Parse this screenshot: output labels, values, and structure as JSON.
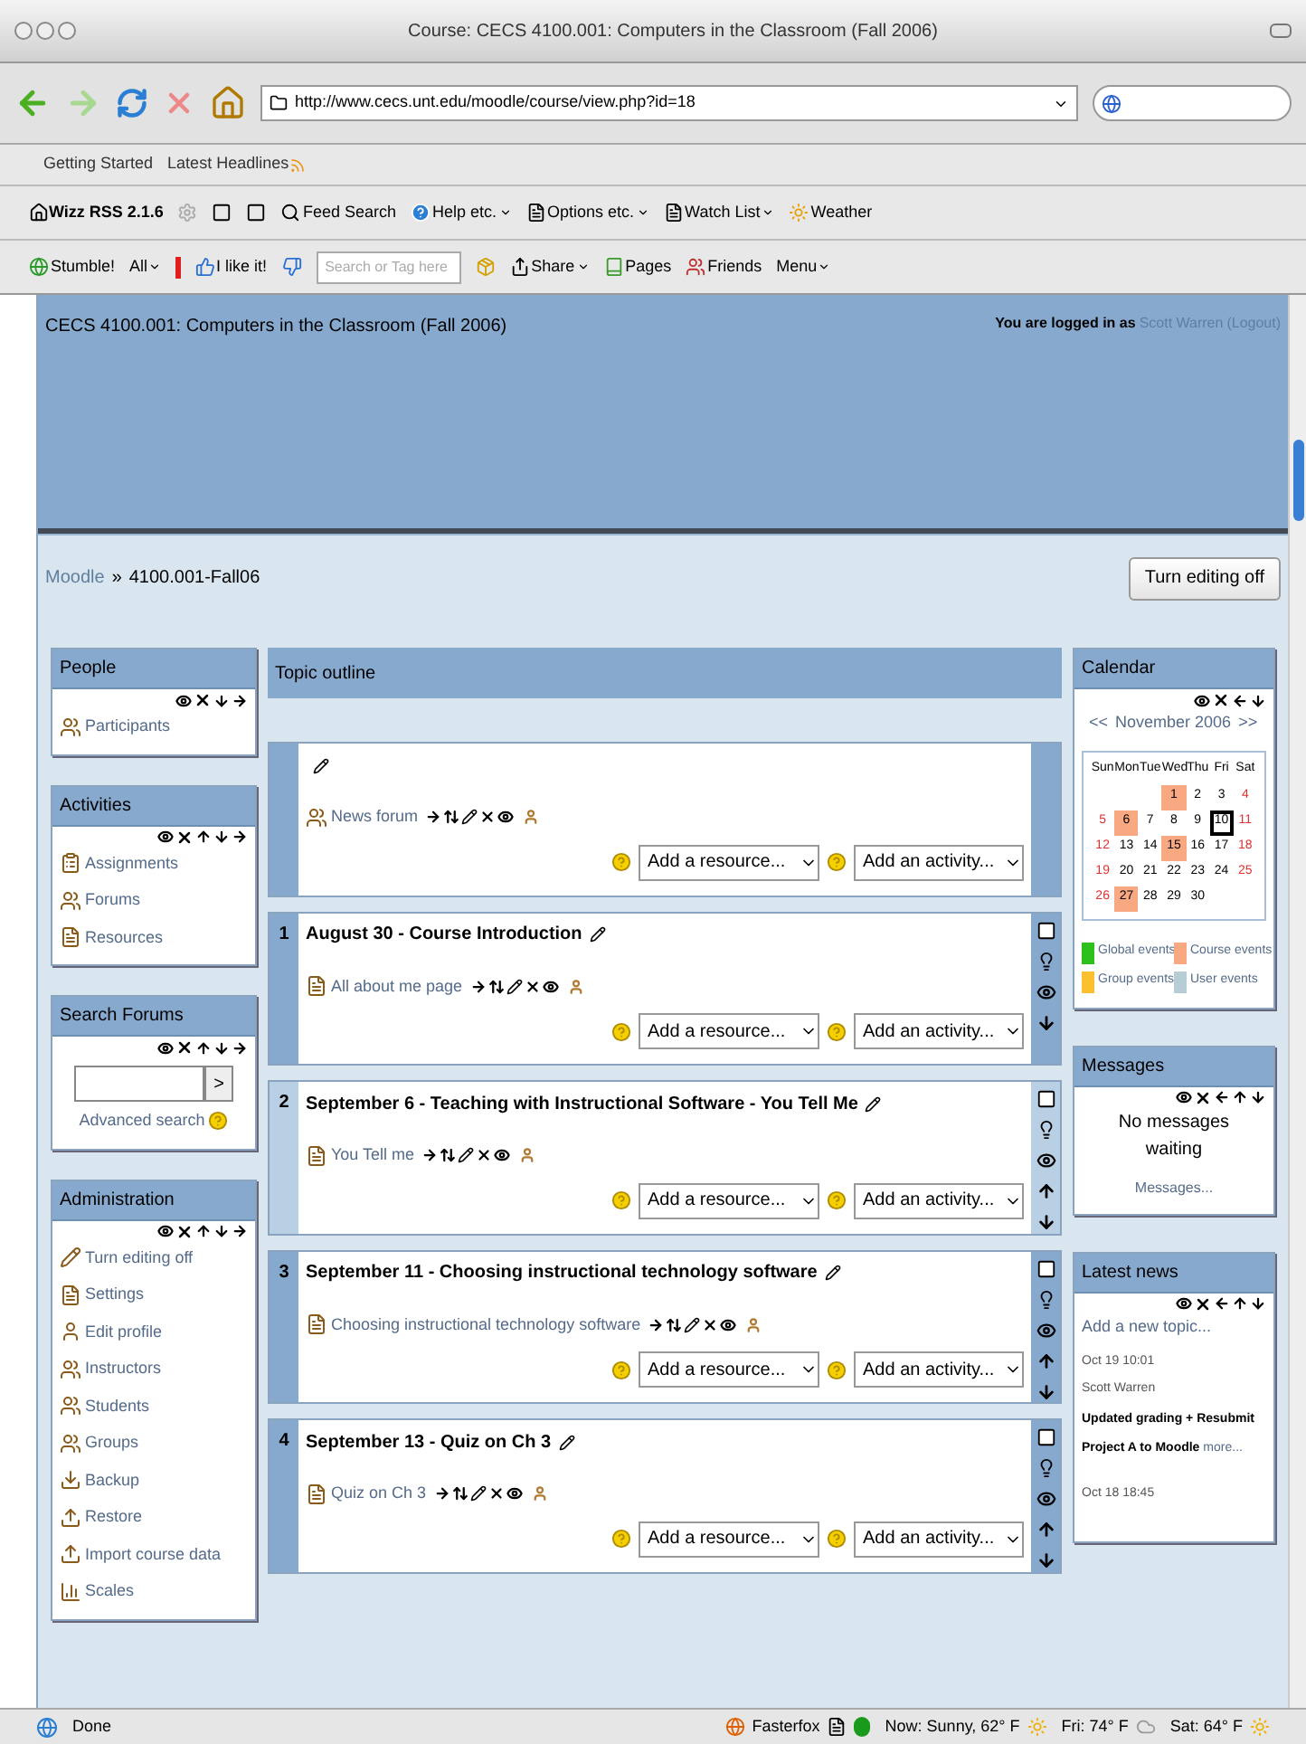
{
  "window": {
    "title": "Course: CECS 4100.001: Computers in the Classroom (Fall 2006)"
  },
  "navigation": {
    "url": "http://www.cecs.unt.edu/moodle/course/view.php?id=18"
  },
  "bookmarks": [
    "Getting Started",
    "Latest Headlines"
  ],
  "wizz_toolbar": {
    "name": "Wizz RSS 2.1.6",
    "items": [
      {
        "label": "Feed Search",
        "menu": false
      },
      {
        "label": "Help etc.",
        "menu": true
      },
      {
        "label": "Options etc.",
        "menu": true
      },
      {
        "label": "Watch List",
        "menu": true
      },
      {
        "label": "Weather",
        "menu": false
      }
    ]
  },
  "stumble_toolbar": {
    "stumble": "Stumble!",
    "all": "All",
    "like": "I like it!",
    "search_placeholder": "Search or Tag here",
    "items": [
      {
        "label": "Share",
        "menu": true
      },
      {
        "label": "Pages",
        "menu": false
      },
      {
        "label": "Friends",
        "menu": false
      },
      {
        "label": "Menu",
        "menu": true
      }
    ]
  },
  "header": {
    "course_title": "CECS 4100.001: Computers in the Classroom (Fall 2006)",
    "login_prefix": "You are logged in as",
    "user": "Scott Warren",
    "logout": "(Logout)"
  },
  "breadcrumb": {
    "home": "Moodle",
    "separator": "»",
    "current": "4100.001-Fall06"
  },
  "edit_button": "Turn editing off",
  "left_blocks": [
    {
      "kind": "list",
      "title": "People",
      "can_move_up": false,
      "items": [
        "Participants"
      ]
    },
    {
      "kind": "list",
      "title": "Activities",
      "can_move_up": true,
      "items": [
        "Assignments",
        "Forums",
        "Resources"
      ]
    },
    {
      "kind": "search",
      "title": "Search Forums",
      "can_move_up": true,
      "button": ">",
      "link": "Advanced search"
    },
    {
      "kind": "list",
      "title": "Administration",
      "can_move_up": true,
      "items": [
        "Turn editing off",
        "Settings",
        "Edit profile",
        "Instructors",
        "Students",
        "Groups",
        "Backup",
        "Restore",
        "Import course data",
        "Scales"
      ]
    }
  ],
  "topic_outline": {
    "title": "Topic outline",
    "sections": [
      {
        "kind": "general",
        "activity": "News forum",
        "resource_select": "Add a resource...",
        "activity_select": "Add an activity...",
        "highlighted": false
      },
      {
        "kind": "week",
        "number": "1",
        "title": "August 30 - Course Introduction",
        "activity": "All about me page",
        "resource_select": "Add a resource...",
        "activity_select": "Add an activity...",
        "highlighted": false,
        "can_move_up": false,
        "can_move_down": true
      },
      {
        "kind": "week",
        "number": "2",
        "title": "September 6 - Teaching with Instructional Software - You Tell Me",
        "activity": "You Tell me",
        "resource_select": "Add a resource...",
        "activity_select": "Add an activity...",
        "highlighted": true,
        "can_move_up": true,
        "can_move_down": true
      },
      {
        "kind": "week",
        "number": "3",
        "title": "September 11 - Choosing instructional technology software",
        "activity": "Choosing instructional technology software",
        "resource_select": "Add a resource...",
        "activity_select": "Add an activity...",
        "highlighted": false,
        "can_move_up": true,
        "can_move_down": true
      },
      {
        "kind": "week",
        "number": "4",
        "title": "September 13 - Quiz on Ch 3",
        "activity": "Quiz on Ch 3",
        "resource_select": "Add a resource...",
        "activity_select": "Add an activity...",
        "highlighted": false,
        "can_move_up": true,
        "can_move_down": true
      }
    ]
  },
  "calendar": {
    "title": "Calendar",
    "prev": "<<",
    "month": "November 2006",
    "next": ">>",
    "weekdays": [
      "Sun",
      "Mon",
      "Tue",
      "Wed",
      "Thu",
      "Fri",
      "Sat"
    ],
    "weeks": [
      {
        "kind": "first",
        "days": [
          {
            "day": "1",
            "event": true,
            "today": false
          },
          {
            "day": "2",
            "event": false,
            "today": false
          },
          {
            "day": "3",
            "event": false,
            "today": false
          },
          {
            "day": "4",
            "event": false,
            "today": false
          }
        ]
      },
      {
        "days": [
          {
            "day": "5",
            "event": false,
            "today": false
          },
          {
            "day": "6",
            "event": true,
            "today": false
          },
          {
            "day": "7",
            "event": false,
            "today": false
          },
          {
            "day": "8",
            "event": false,
            "today": false
          },
          {
            "day": "9",
            "event": false,
            "today": false
          },
          {
            "day": "10",
            "event": false,
            "today": true
          },
          {
            "day": "11",
            "event": false,
            "today": false
          }
        ]
      },
      {
        "days": [
          {
            "day": "12",
            "event": false,
            "today": false
          },
          {
            "day": "13",
            "event": false,
            "today": false
          },
          {
            "day": "14",
            "event": false,
            "today": false
          },
          {
            "day": "15",
            "event": true,
            "today": false
          },
          {
            "day": "16",
            "event": false,
            "today": false
          },
          {
            "day": "17",
            "event": false,
            "today": false
          },
          {
            "day": "18",
            "event": false,
            "today": false
          }
        ]
      },
      {
        "days": [
          {
            "day": "19",
            "event": false,
            "today": false
          },
          {
            "day": "20",
            "event": false,
            "today": false
          },
          {
            "day": "21",
            "event": false,
            "today": false
          },
          {
            "day": "22",
            "event": false,
            "today": false
          },
          {
            "day": "23",
            "event": false,
            "today": false
          },
          {
            "day": "24",
            "event": false,
            "today": false
          },
          {
            "day": "25",
            "event": false,
            "today": false
          }
        ]
      },
      {
        "kind": "last",
        "days": [
          {
            "day": "26",
            "event": false,
            "today": false
          },
          {
            "day": "27",
            "event": true,
            "today": false
          },
          {
            "day": "28",
            "event": false,
            "today": false
          },
          {
            "day": "29",
            "event": false,
            "today": false
          },
          {
            "day": "30",
            "event": false,
            "today": false
          }
        ]
      }
    ],
    "legend": [
      {
        "label": "Global events",
        "color": "#2ec11d"
      },
      {
        "label": "Course events",
        "color": "#f9a982"
      },
      {
        "label": "Group events",
        "color": "#fbc02d"
      },
      {
        "label": "User events",
        "color": "#b7cdd6"
      }
    ]
  },
  "messages": {
    "title": "Messages",
    "text": "No messages waiting",
    "link": "Messages..."
  },
  "latest_news": {
    "title": "Latest news",
    "add": "Add a new topic...",
    "items": [
      {
        "date": "Oct 19 10:01",
        "author": "Scott Warren",
        "text": "Updated grading + Resubmit Project A to Moodle",
        "more": "more..."
      },
      {
        "date": "Oct 18 18:45"
      }
    ]
  },
  "status_bar": {
    "status": "Done",
    "items": [
      "Fasterfox",
      "Now: Sunny, 62° F",
      "Fri: 74° F",
      "Sat: 64° F"
    ]
  }
}
